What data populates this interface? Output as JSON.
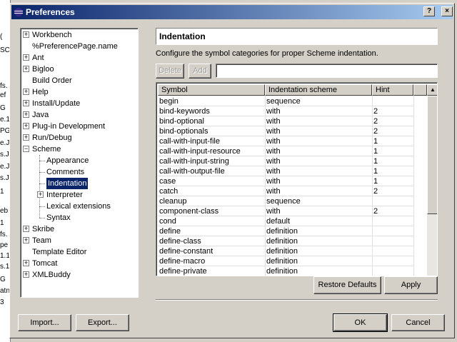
{
  "background_left_strip": [
    "(",
    "SC",
    "fs.",
    "ef",
    "G",
    "e.1",
    "PG",
    "e.JP",
    "s.J",
    "e.JP",
    "s.J",
    "1",
    "eb",
    "1",
    "fs.",
    "pe",
    "1.1",
    "s.1",
    "G",
    "atn",
    "3"
  ],
  "window": {
    "title": "Preferences",
    "buttons": {
      "help": "?",
      "close": "×"
    }
  },
  "tree": {
    "items": [
      {
        "label": "Workbench",
        "expander": "+"
      },
      {
        "label": "%PreferencePage.name",
        "expander": ""
      },
      {
        "label": "Ant",
        "expander": "+"
      },
      {
        "label": "Bigloo",
        "expander": "+"
      },
      {
        "label": "Build Order",
        "expander": ""
      },
      {
        "label": "Help",
        "expander": "+"
      },
      {
        "label": "Install/Update",
        "expander": "+"
      },
      {
        "label": "Java",
        "expander": "+"
      },
      {
        "label": "Plug-in Development",
        "expander": "+"
      },
      {
        "label": "Run/Debug",
        "expander": "+"
      },
      {
        "label": "Scheme",
        "expander": "−"
      },
      {
        "label": "Appearance",
        "expander": ""
      },
      {
        "label": "Comments",
        "expander": ""
      },
      {
        "label": "Indentation",
        "expander": ""
      },
      {
        "label": "Interpreter",
        "expander": "+"
      },
      {
        "label": "Lexical extensions",
        "expander": ""
      },
      {
        "label": "Syntax",
        "expander": ""
      },
      {
        "label": "Skribe",
        "expander": "+"
      },
      {
        "label": "Team",
        "expander": "+"
      },
      {
        "label": "Template Editor",
        "expander": ""
      },
      {
        "label": "Tomcat",
        "expander": "+"
      },
      {
        "label": "XMLBuddy",
        "expander": "+"
      }
    ],
    "selected": "Indentation"
  },
  "page": {
    "title": "Indentation",
    "description": "Configure the symbol categories for proper Scheme indentation.",
    "delete_label": "Delete",
    "add_label": "Add",
    "input_value": ""
  },
  "table": {
    "columns": [
      "Symbol",
      "Indentation scheme",
      "Hint"
    ],
    "rows": [
      [
        "begin",
        "sequence",
        ""
      ],
      [
        "bind-keywords",
        "with",
        "2"
      ],
      [
        "bind-optional",
        "with",
        "2"
      ],
      [
        "bind-optionals",
        "with",
        "2"
      ],
      [
        "call-with-input-file",
        "with",
        "1"
      ],
      [
        "call-with-input-resource",
        "with",
        "1"
      ],
      [
        "call-with-input-string",
        "with",
        "1"
      ],
      [
        "call-with-output-file",
        "with",
        "1"
      ],
      [
        "case",
        "with",
        "1"
      ],
      [
        "catch",
        "with",
        "2"
      ],
      [
        "cleanup",
        "sequence",
        ""
      ],
      [
        "component-class",
        "with",
        "2"
      ],
      [
        "cond",
        "default",
        ""
      ],
      [
        "define",
        "definition",
        ""
      ],
      [
        "define-class",
        "definition",
        ""
      ],
      [
        "define-constant",
        "definition",
        ""
      ],
      [
        "define-macro",
        "definition",
        ""
      ],
      [
        "define-private",
        "definition",
        ""
      ]
    ]
  },
  "actions": {
    "restore_defaults": "Restore Defaults",
    "apply": "Apply",
    "import": "Import...",
    "export": "Export...",
    "ok": "OK",
    "cancel": "Cancel"
  },
  "colors": {
    "selection": "#0a246a",
    "titlebar_start": "#0a246a",
    "titlebar_end": "#a6caf0",
    "face": "#d4d0c8"
  }
}
